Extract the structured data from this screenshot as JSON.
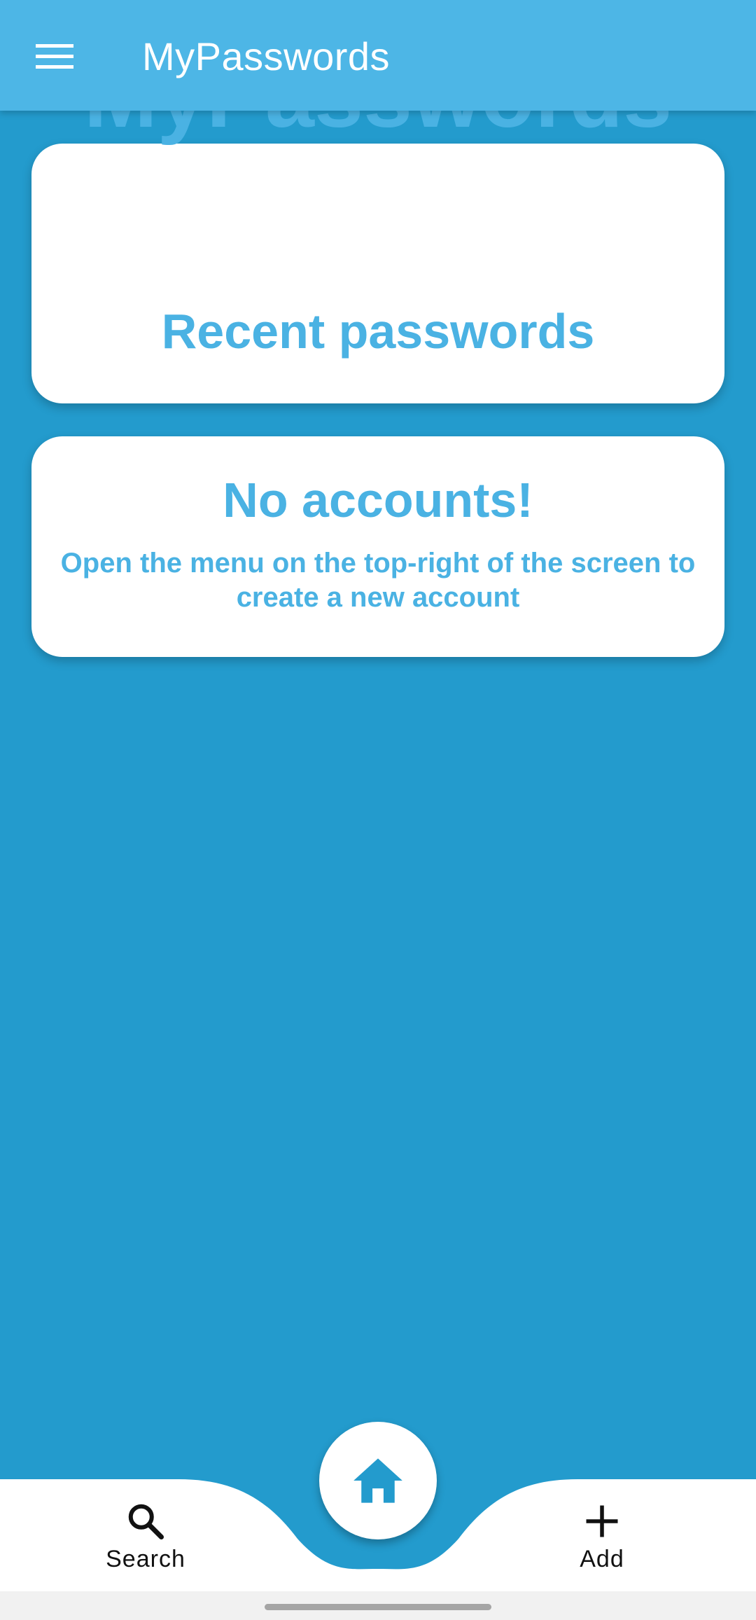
{
  "app_bar": {
    "title": "MyPasswords",
    "menu_icon": "hamburger-menu-icon"
  },
  "header_card": {
    "title": "MyPasswords",
    "subtitle": "Recent passwords"
  },
  "empty_state": {
    "title": "No accounts!",
    "message": "Open the menu on the top-right of the screen to create a new account"
  },
  "bottom_nav": {
    "search_label": "Search",
    "search_icon": "search-icon",
    "add_label": "Add",
    "add_icon": "plus-icon",
    "home_icon": "home-icon"
  },
  "colors": {
    "app_bar": "#4db6e6",
    "background": "#239bcd",
    "accent_text": "#4ab2e3",
    "card": "#ffffff",
    "nav_bar": "#ffffff"
  }
}
